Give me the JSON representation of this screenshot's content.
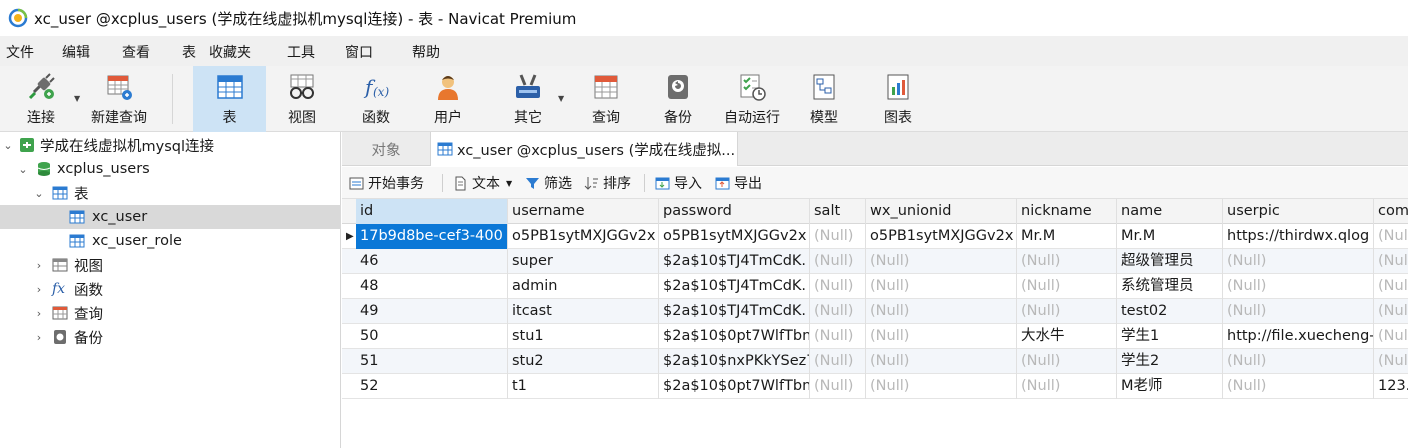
{
  "window": {
    "title": "xc_user @xcplus_users (学成在线虚拟机mysql连接) - 表 - Navicat Premium"
  },
  "menu": [
    "文件",
    "编辑",
    "查看",
    "表",
    "收藏夹",
    "工具",
    "窗口",
    "帮助"
  ],
  "toolbar": {
    "items": [
      {
        "label": "连接",
        "icon": "plug-icon"
      },
      {
        "label": "新建查询",
        "icon": "new-query-icon"
      },
      {
        "label": "表",
        "icon": "table-icon"
      },
      {
        "label": "视图",
        "icon": "view-glasses-icon"
      },
      {
        "label": "函数",
        "icon": "function-icon"
      },
      {
        "label": "用户",
        "icon": "user-icon"
      },
      {
        "label": "其它",
        "icon": "tools-icon"
      },
      {
        "label": "查询",
        "icon": "query-icon"
      },
      {
        "label": "备份",
        "icon": "backup-icon"
      },
      {
        "label": "自动运行",
        "icon": "automation-icon"
      },
      {
        "label": "模型",
        "icon": "model-icon"
      },
      {
        "label": "图表",
        "icon": "chart-icon"
      }
    ],
    "active": "表"
  },
  "tree": {
    "connection": "学成在线虚拟机mysql连接",
    "database": "xcplus_users",
    "tables_node": "表",
    "tables": [
      "xc_user",
      "xc_user_role"
    ],
    "selected_table": "xc_user",
    "others": [
      "视图",
      "函数",
      "查询",
      "备份"
    ]
  },
  "tabs": {
    "objects": "对象",
    "active": "xc_user @xcplus_users (学成在线虚拟..."
  },
  "subtoolbar": {
    "begin_transaction": "开始事务",
    "text": "文本",
    "filter": "筛选",
    "sort": "排序",
    "import": "导入",
    "export": "导出"
  },
  "grid": {
    "columns": [
      "id",
      "username",
      "password",
      "salt",
      "wx_unionid",
      "nickname",
      "name",
      "userpic",
      "com"
    ],
    "rows": [
      [
        "17b9d8be-cef3-400",
        "o5PB1sytMXJGGv2x",
        "o5PB1sytMXJGGv2x",
        "(Null)",
        "o5PB1sytMXJGGv2x",
        "Mr.M",
        "Mr.M",
        "https://thirdwx.qlog",
        "(Nul"
      ],
      [
        "46",
        "super",
        "$2a$10$TJ4TmCdK.",
        "(Null)",
        "(Null)",
        "(Null)",
        "超级管理员",
        "(Null)",
        "(Nul"
      ],
      [
        "48",
        "admin",
        "$2a$10$TJ4TmCdK.",
        "(Null)",
        "(Null)",
        "(Null)",
        "系统管理员",
        "(Null)",
        "(Nul"
      ],
      [
        "49",
        "itcast",
        "$2a$10$TJ4TmCdK.",
        "(Null)",
        "(Null)",
        "(Null)",
        "test02",
        "(Null)",
        "(Nul"
      ],
      [
        "50",
        "stu1",
        "$2a$10$0pt7WlfTbn",
        "(Null)",
        "(Null)",
        "大水牛",
        "学生1",
        "http://file.xuecheng-",
        "(Nul"
      ],
      [
        "51",
        "stu2",
        "$2a$10$nxPKkYSez7",
        "(Null)",
        "(Null)",
        "(Null)",
        "学生2",
        "(Null)",
        "(Nul"
      ],
      [
        "52",
        "t1",
        "$2a$10$0pt7WlfTbn",
        "(Null)",
        "(Null)",
        "(Null)",
        "M老师",
        "(Null)",
        "123."
      ]
    ]
  },
  "colors": {
    "accent": "#0b78d7",
    "toolbar_active": "#cde3f5",
    "null_text": "#b8b8b8",
    "tree_selected": "#d9d9d9"
  }
}
